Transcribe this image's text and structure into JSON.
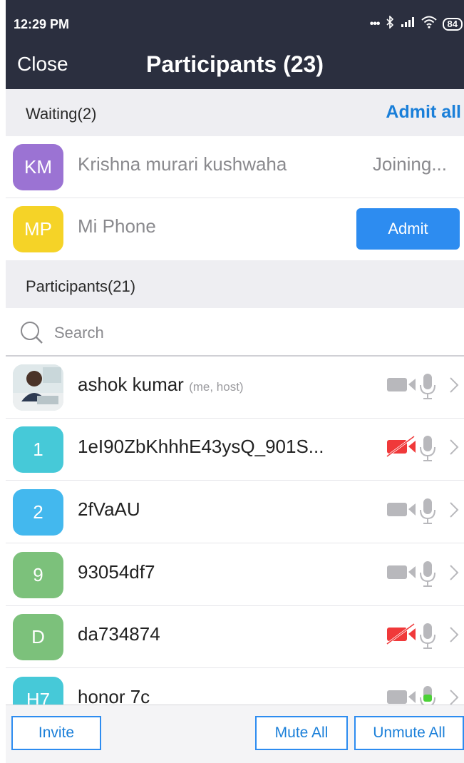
{
  "status_bar": {
    "time": "12:29 PM",
    "battery": "84"
  },
  "nav": {
    "close_label": "Close",
    "title": "Participants (23)"
  },
  "waiting": {
    "header": "Waiting(2)",
    "admit_all_label": "Admit all",
    "items": [
      {
        "initials": "KM",
        "name": "Krishna murari kushwaha",
        "status": "Joining...",
        "color": "#9b73d3"
      },
      {
        "initials": "MP",
        "name": "Mi Phone",
        "action": "Admit",
        "color": "#f5d327"
      }
    ]
  },
  "participants": {
    "header": "Participants(21)",
    "search_placeholder": "Search",
    "items": [
      {
        "initials": "",
        "name": "ashok kumar",
        "tag": "(me, host)",
        "video_off": false,
        "mic_active": false
      },
      {
        "initials": "1",
        "name": "1eI90ZbKhhhE43ysQ_901S...",
        "video_off": true,
        "mic_active": false,
        "color": "#46c9d8"
      },
      {
        "initials": "2",
        "name": "2fVaAU",
        "video_off": false,
        "mic_active": false,
        "color": "#43b8ee"
      },
      {
        "initials": "9",
        "name": "93054df7",
        "video_off": false,
        "mic_active": false,
        "color": "#7cc17b"
      },
      {
        "initials": "D",
        "name": "da734874",
        "video_off": true,
        "mic_active": false,
        "color": "#7cc17b"
      },
      {
        "initials": "H7",
        "name": "honor 7c",
        "video_off": false,
        "mic_active": true,
        "color": "#46c9d8"
      }
    ]
  },
  "footer": {
    "invite_label": "Invite",
    "mute_all_label": "Mute All",
    "unmute_all_label": "Unmute All"
  },
  "colors": {
    "header_bg": "#2b2f3f",
    "accent": "#2d8cf0",
    "video_off": "#f0393a",
    "mic_active": "#4cd137"
  }
}
